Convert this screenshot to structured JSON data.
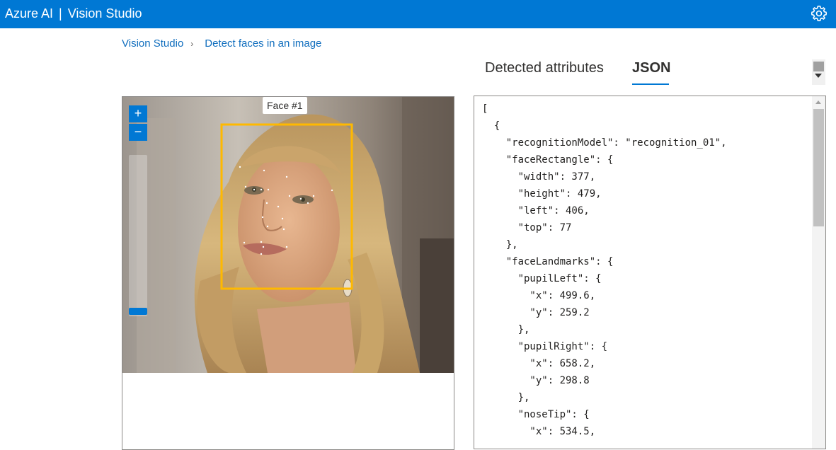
{
  "header": {
    "brand_left": "Azure AI",
    "brand_separator": "|",
    "brand_right": "Vision Studio",
    "settings_icon": "gear-icon",
    "accent": "#0078d4"
  },
  "breadcrumb": {
    "items": [
      "Vision Studio",
      "Detect faces in an image"
    ],
    "separator_icon": "chevron-right-icon"
  },
  "tabs": [
    {
      "label": "Detected attributes",
      "active": false
    },
    {
      "label": "JSON",
      "active": true
    }
  ],
  "image_viewer": {
    "zoom_in_label": "+",
    "zoom_out_label": "−",
    "face_label": "Face #1",
    "box_color": "#ffb900"
  },
  "json_lines": [
    "[",
    "  {",
    "    \"recognitionModel\": \"recognition_01\",",
    "    \"faceRectangle\": {",
    "      \"width\": 377,",
    "      \"height\": 479,",
    "      \"left\": 406,",
    "      \"top\": 77",
    "    },",
    "    \"faceLandmarks\": {",
    "      \"pupilLeft\": {",
    "        \"x\": 499.6,",
    "        \"y\": 259.2",
    "      },",
    "      \"pupilRight\": {",
    "        \"x\": 658.2,",
    "        \"y\": 298.8",
    "      },",
    "      \"noseTip\": {",
    "        \"x\": 534.5,"
  ]
}
